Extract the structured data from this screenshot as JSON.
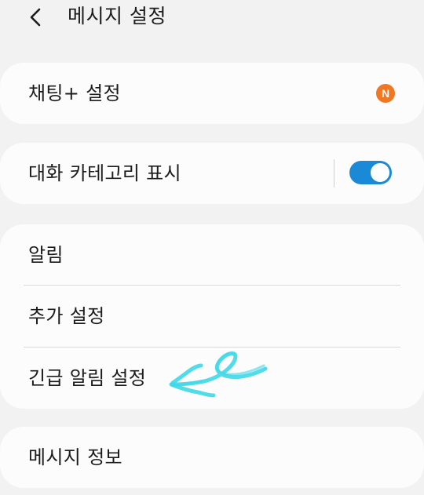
{
  "header": {
    "title": "메시지 설정",
    "back_icon": "chevron-left-icon"
  },
  "items": {
    "chat_plus": {
      "label": "채팅+ 설정",
      "badge": "N",
      "badge_color": "#f07823"
    },
    "category": {
      "label": "대화 카테고리 표시",
      "toggle_on": true,
      "toggle_color": "#1a8ad6"
    },
    "notifications": {
      "label": "알림"
    },
    "more_settings": {
      "label": "추가 설정"
    },
    "emergency": {
      "label": "긴급 알림 설정"
    },
    "info": {
      "label": "메시지 정보"
    }
  },
  "annotation": {
    "type": "hand-drawn-arrow",
    "color": "#3fd7e6"
  }
}
